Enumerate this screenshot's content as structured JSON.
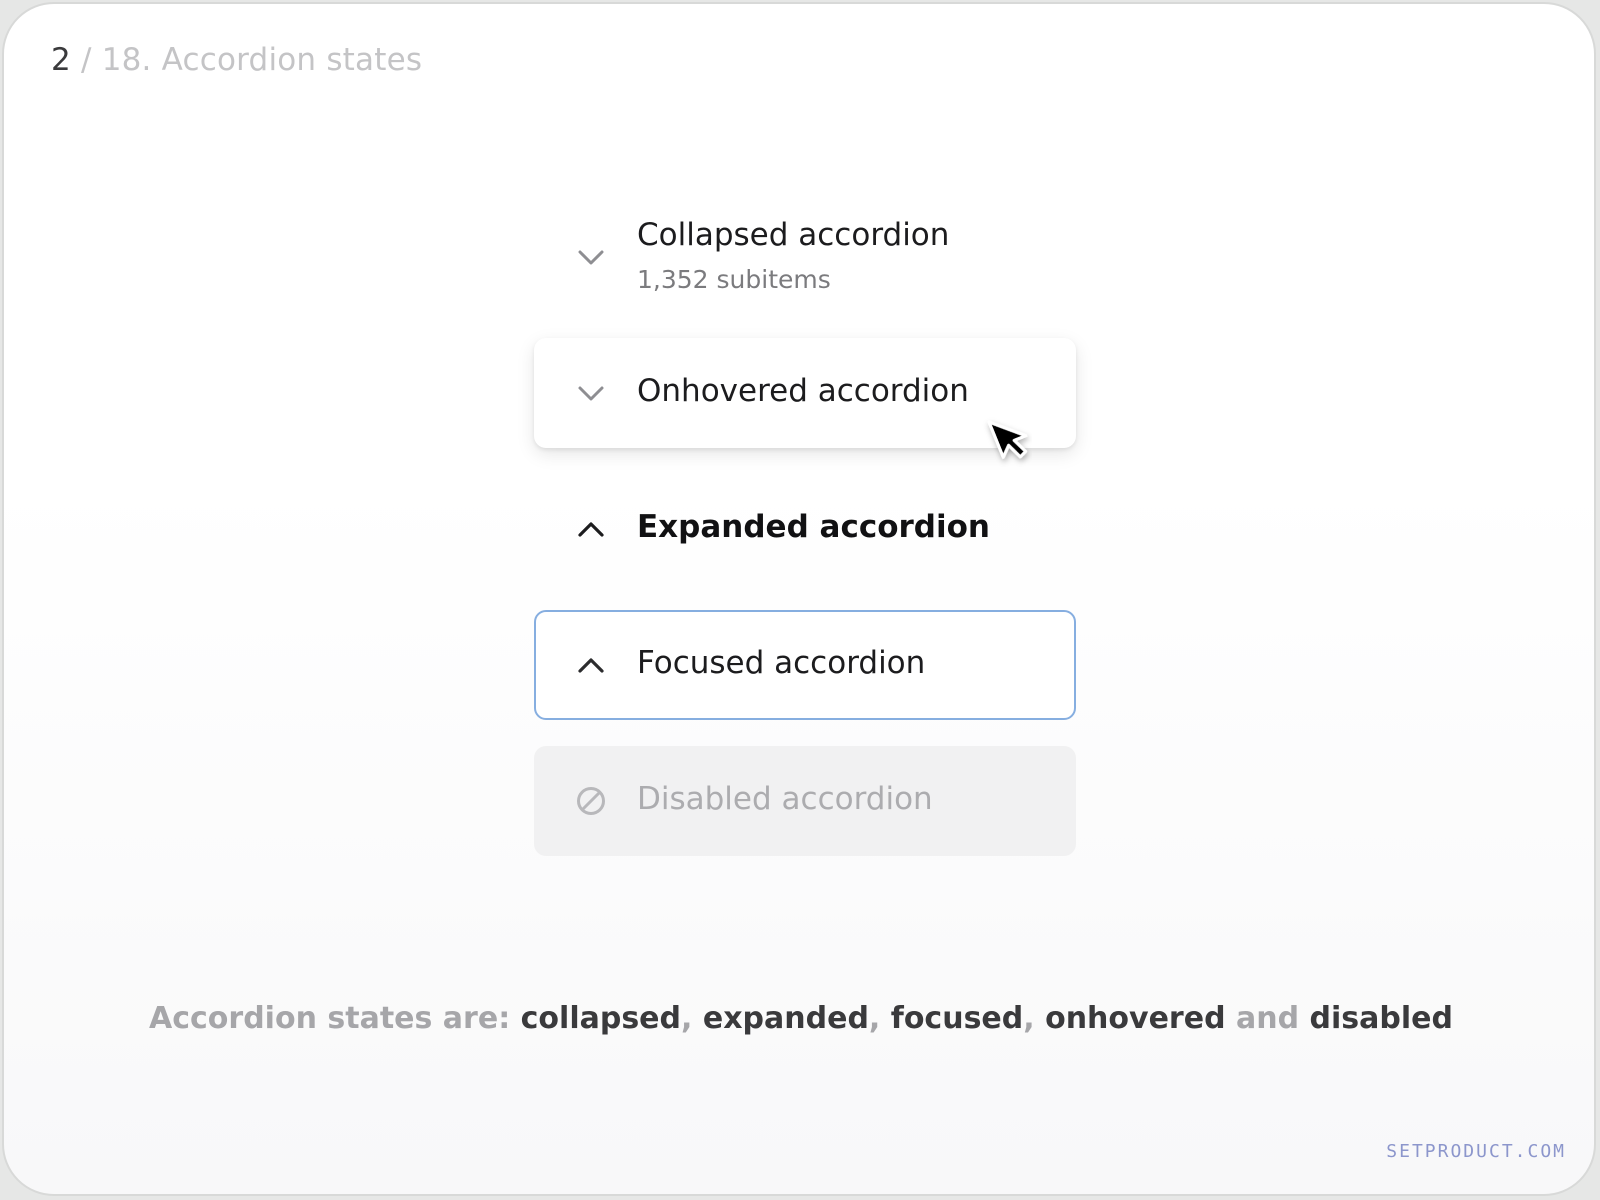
{
  "header": {
    "page_current": "2",
    "page_rest": " / 18. Accordion states"
  },
  "accordions": [
    {
      "state": "collapsed",
      "label": "Collapsed accordion",
      "subtitle": "1,352 subitems",
      "icon": "chevron-down-icon"
    },
    {
      "state": "onhovered",
      "label": "Onhovered accordion",
      "icon": "chevron-down-icon"
    },
    {
      "state": "expanded",
      "label": "Expanded accordion",
      "icon": "chevron-up-icon"
    },
    {
      "state": "focused",
      "label": "Focused accordion",
      "icon": "chevron-up-icon",
      "focus_color": "#86aee0"
    },
    {
      "state": "disabled",
      "label": "Disabled accordion",
      "icon": "disabled-icon"
    }
  ],
  "cursor": {
    "icon": "mouse-pointer-icon"
  },
  "footnote": {
    "prefix": "Accordion states are: ",
    "s1": "collapsed",
    "sep1": ", ",
    "s2": "expanded",
    "sep2": ", ",
    "s3": "focused",
    "sep3": ", ",
    "s4": "onhovered",
    "and": " and ",
    "s5": "disabled"
  },
  "brand": {
    "text": "SETPRODUCT.COM",
    "color": "#8c96cc"
  }
}
